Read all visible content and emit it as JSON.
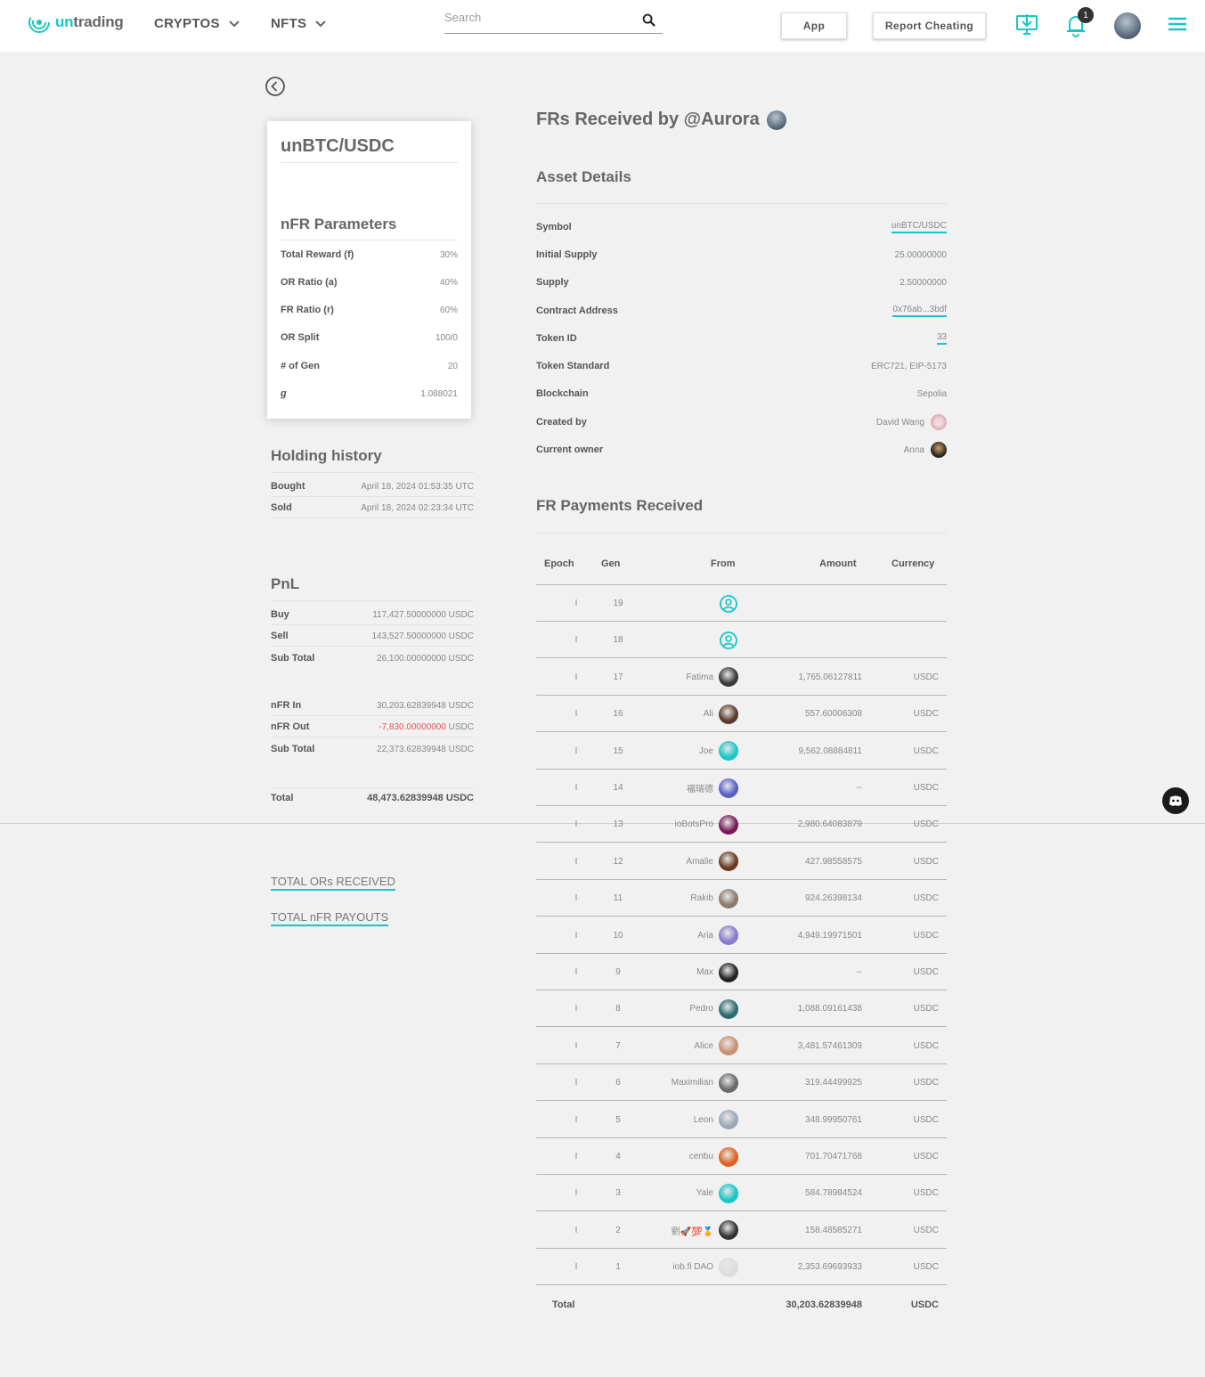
{
  "header": {
    "logo_prefix": "un",
    "logo_suffix": "trading",
    "nav": [
      {
        "label": "CRYPTOS"
      },
      {
        "label": "NFTS"
      }
    ],
    "search_placeholder": "Search",
    "app_button": "App",
    "report_button": "Report Cheating",
    "notification_count": "1"
  },
  "card": {
    "title": "unBTC/USDC",
    "params_title": "nFR Parameters",
    "params": [
      {
        "label": "Total Reward (f)",
        "value": "30%"
      },
      {
        "label": "OR Ratio (a)",
        "value": "40%"
      },
      {
        "label": "FR Ratio (r)",
        "value": "60%"
      },
      {
        "label": "OR Split",
        "value": "100/0"
      },
      {
        "label": "# of Gen",
        "value": "20"
      },
      {
        "label": "g",
        "value": "1.088021"
      }
    ]
  },
  "holding": {
    "title": "Holding history",
    "rows": [
      {
        "label": "Bought",
        "value": "April 18, 2024 01:53:35 UTC"
      },
      {
        "label": "Sold",
        "value": "April 18, 2024 02:23:34 UTC"
      }
    ]
  },
  "pnl": {
    "title": "PnL",
    "buy": {
      "label": "Buy",
      "value": "117,427.50000000 USDC"
    },
    "sell": {
      "label": "Sell",
      "value": "143,527.50000000 USDC"
    },
    "subtotal1": {
      "label": "Sub Total",
      "value": "26,100.00000000 USDC"
    },
    "nfr_in": {
      "label": "nFR In",
      "value": "30,203.62839948 USDC"
    },
    "nfr_out": {
      "label": "nFR Out",
      "value_neg": "-7,830.00000000",
      "unit": " USDC"
    },
    "subtotal2": {
      "label": "Sub Total",
      "value": "22,373.62839948 USDC"
    },
    "total": {
      "label": "Total",
      "value": "48,473.62839948 USDC"
    }
  },
  "links": {
    "ors": "TOTAL ORs RECEIVED",
    "payouts": "TOTAL nFR PAYOUTS"
  },
  "main": {
    "title": "FRs Received by @Aurora",
    "asset_title": "Asset Details",
    "assets": [
      {
        "label": "Symbol",
        "value": "unBTC/USDC"
      },
      {
        "label": "Initial Supply",
        "value": "25.00000000"
      },
      {
        "label": "Supply",
        "value": "2.50000000"
      },
      {
        "label": "Contract Address",
        "value": "0x76ab...3bdf"
      },
      {
        "label": "Token ID",
        "value": "33"
      },
      {
        "label": "Token Standard",
        "value": "ERC721, EIP-5173"
      },
      {
        "label": "Blockchain",
        "value": "Sepolia"
      },
      {
        "label": "Created by",
        "value": "David Wang"
      },
      {
        "label": "Current owner",
        "value": "Anna"
      }
    ],
    "payments_title": "FR Payments Received"
  },
  "table": {
    "headers": {
      "epoch": "Epoch",
      "gen": "Gen",
      "from": "From",
      "amount": "Amount",
      "currency": "Currency"
    },
    "rows": [
      {
        "epoch": "I",
        "gen": "19",
        "from": "",
        "amount": "",
        "currency": "",
        "avatar": "user-outline",
        "color": "#19c6c6"
      },
      {
        "epoch": "I",
        "gen": "18",
        "from": "",
        "amount": "",
        "currency": "",
        "avatar": "user-outline",
        "color": "#19c6c6"
      },
      {
        "epoch": "I",
        "gen": "17",
        "from": "Fatima",
        "amount": "1,765.06127811",
        "currency": "USDC",
        "color": "#3a3a3a"
      },
      {
        "epoch": "I",
        "gen": "16",
        "from": "Ali",
        "amount": "557.60006308",
        "currency": "USDC",
        "color": "#5a3a2a"
      },
      {
        "epoch": "I",
        "gen": "15",
        "from": "Joe",
        "amount": "9,562.08884811",
        "currency": "USDC",
        "color": "#19c6c6"
      },
      {
        "epoch": "I",
        "gen": "14",
        "from": "福瑞德",
        "amount": "--",
        "currency": "USDC",
        "color": "#5560c8"
      },
      {
        "epoch": "I",
        "gen": "13",
        "from": "ioBotsPro",
        "amount": "2,980.64083879",
        "currency": "USDC",
        "color": "#7a1a5a"
      },
      {
        "epoch": "I",
        "gen": "12",
        "from": "Amalie",
        "amount": "427.98558575",
        "currency": "USDC",
        "color": "#6a3a20"
      },
      {
        "epoch": "I",
        "gen": "11",
        "from": "Rakib",
        "amount": "924.26398134",
        "currency": "USDC",
        "color": "#8a7a6a"
      },
      {
        "epoch": "I",
        "gen": "10",
        "from": "Aria",
        "amount": "4,949.19971501",
        "currency": "USDC",
        "color": "#8a7ad0"
      },
      {
        "epoch": "I",
        "gen": "9",
        "from": "Max",
        "amount": "--",
        "currency": "USDC",
        "color": "#222222"
      },
      {
        "epoch": "I",
        "gen": "8",
        "from": "Pedro",
        "amount": "1,088.09161438",
        "currency": "USDC",
        "color": "#2a6a70"
      },
      {
        "epoch": "I",
        "gen": "7",
        "from": "Alice",
        "amount": "3,481.57461309",
        "currency": "USDC",
        "color": "#c89070"
      },
      {
        "epoch": "I",
        "gen": "6",
        "from": "Maximilian",
        "amount": "319.44499925",
        "currency": "USDC",
        "color": "#6a6a6a"
      },
      {
        "epoch": "I",
        "gen": "5",
        "from": "Leon",
        "amount": "348.99950761",
        "currency": "USDC",
        "color": "#9aa8b8"
      },
      {
        "epoch": "I",
        "gen": "4",
        "from": "cenbu",
        "amount": "701.70471768",
        "currency": "USDC",
        "color": "#e06020"
      },
      {
        "epoch": "I",
        "gen": "3",
        "from": "Yale",
        "amount": "584.78984524",
        "currency": "USDC",
        "color": "#19c6c6"
      },
      {
        "epoch": "I",
        "gen": "2",
        "from": "劉🚀💯🏅",
        "amount": "158.48585271",
        "currency": "USDC",
        "color": "#333333"
      },
      {
        "epoch": "I",
        "gen": "1",
        "from": "iob.fi DAO",
        "amount": "2,353.69693933",
        "currency": "USDC",
        "color": "#dddddd"
      }
    ],
    "total_label": "Total",
    "total_amount": "30,203.62839948",
    "total_currency": "USDC"
  }
}
